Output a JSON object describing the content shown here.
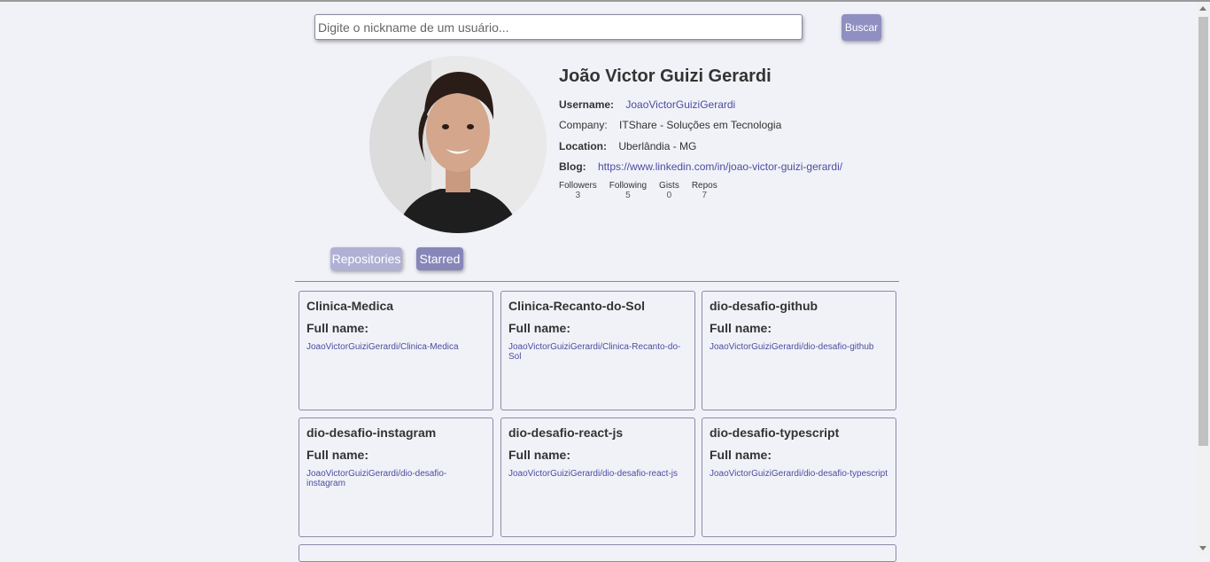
{
  "search": {
    "placeholder": "Digite o nickname de um usuário...",
    "button_label": "Buscar"
  },
  "profile": {
    "name": "João Victor Guizi Gerardi",
    "username_label": "Username:",
    "username": "JoaoVictorGuiziGerardi",
    "company_label": "Company:",
    "company": "ITShare - Soluções em Tecnologia",
    "location_label": "Location:",
    "location": "Uberlândia - MG",
    "blog_label": "Blog:",
    "blog": "https://www.linkedin.com/in/joao-victor-guizi-gerardi/",
    "stats": [
      {
        "label": "Followers",
        "value": "3"
      },
      {
        "label": "Following",
        "value": "5"
      },
      {
        "label": "Gists",
        "value": "0"
      },
      {
        "label": "Repos",
        "value": "7"
      }
    ]
  },
  "tabs": {
    "repositories": "Repositories",
    "starred": "Starred"
  },
  "repos": [
    {
      "name": "Clinica-Medica",
      "full_name_label": "Full name:",
      "full_name": "JoaoVictorGuiziGerardi/Clinica-Medica"
    },
    {
      "name": "Clinica-Recanto-do-Sol",
      "full_name_label": "Full name:",
      "full_name": "JoaoVictorGuiziGerardi/Clinica-Recanto-do-Sol"
    },
    {
      "name": "dio-desafio-github",
      "full_name_label": "Full name:",
      "full_name": "JoaoVictorGuiziGerardi/dio-desafio-github"
    },
    {
      "name": "dio-desafio-instagram",
      "full_name_label": "Full name:",
      "full_name": "JoaoVictorGuiziGerardi/dio-desafio-instagram"
    },
    {
      "name": "dio-desafio-react-js",
      "full_name_label": "Full name:",
      "full_name": "JoaoVictorGuiziGerardi/dio-desafio-react-js"
    },
    {
      "name": "dio-desafio-typescript",
      "full_name_label": "Full name:",
      "full_name": "JoaoVictorGuiziGerardi/dio-desafio-typescript"
    }
  ],
  "colors": {
    "accent": "#8f8fc2",
    "link": "#4c4ca0",
    "background": "#f1f2f8"
  }
}
